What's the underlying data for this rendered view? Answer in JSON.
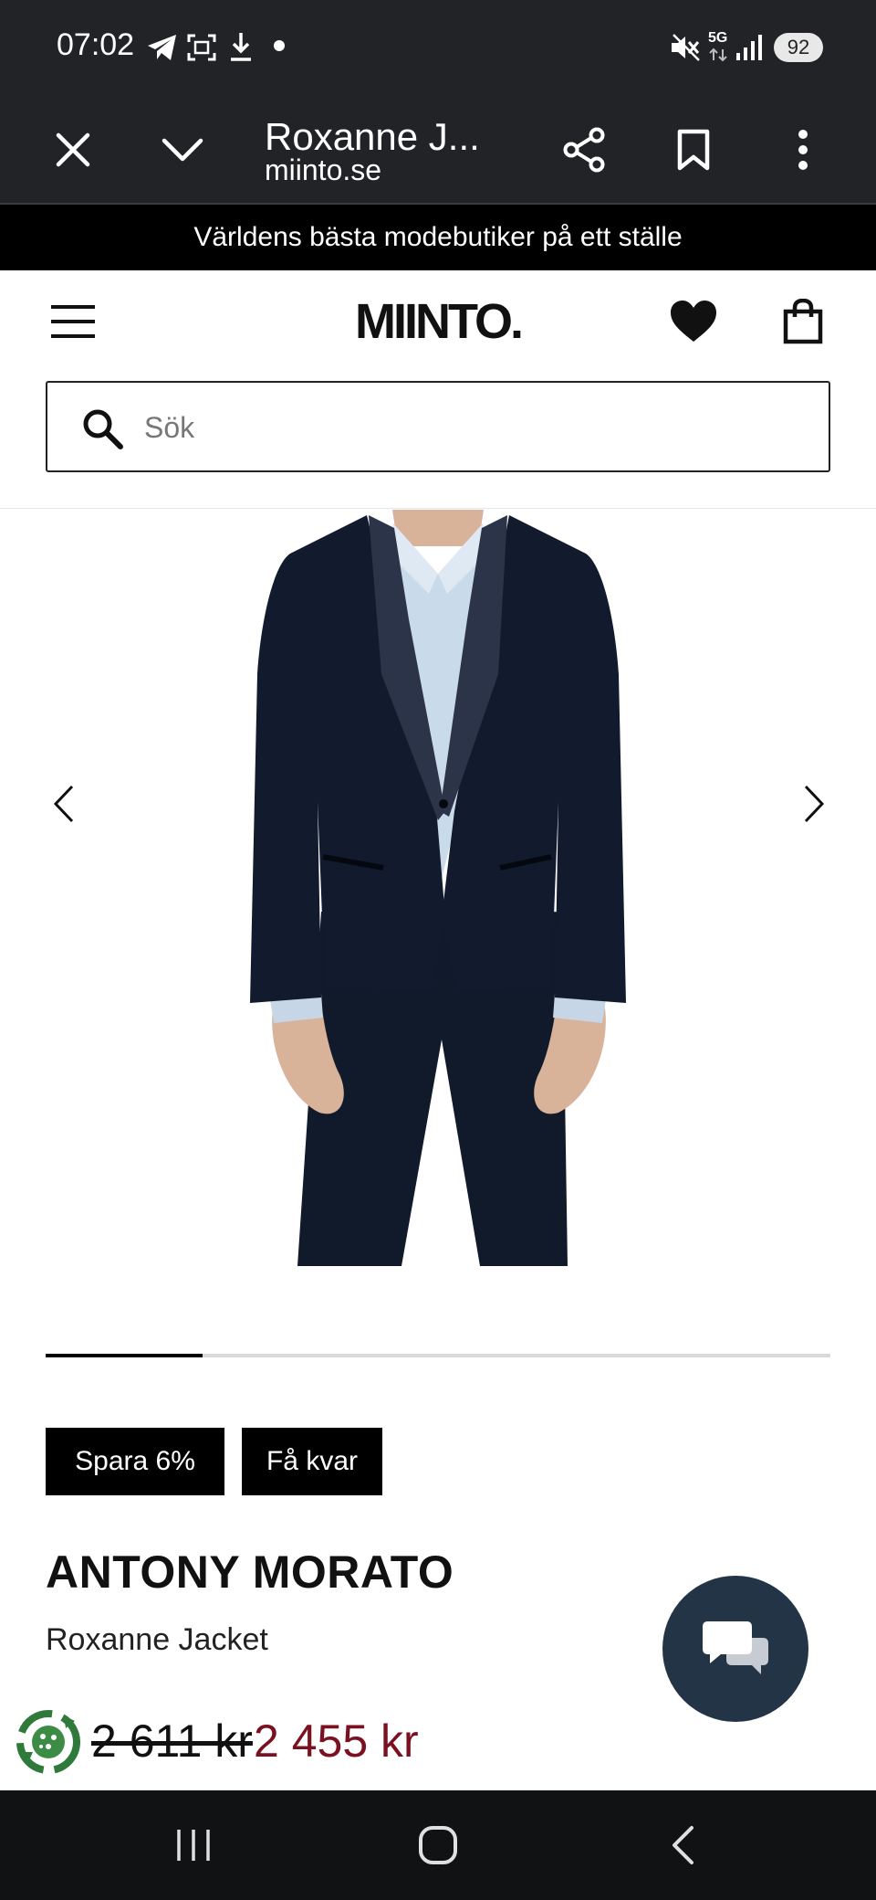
{
  "status_bar": {
    "time": "07:02",
    "battery": "92",
    "network": "5G"
  },
  "browser": {
    "title": "Roxanne J...",
    "domain": "miinto.se",
    "icons": [
      "close-icon",
      "chevron-down-icon",
      "share-icon",
      "bookmark-icon",
      "more-vert-icon"
    ]
  },
  "promo_banner": {
    "text": "Världens bästa modebutiker på ett ställe"
  },
  "header": {
    "logo": "MIINTO.",
    "search_placeholder": "Sök",
    "icons": [
      "hamburger-menu-icon",
      "heart-icon",
      "shopping-bag-icon",
      "search-icon"
    ]
  },
  "gallery": {
    "image_progress": 0.2,
    "icons": [
      "chevron-left-icon",
      "chevron-right-icon"
    ]
  },
  "product": {
    "badges": [
      "Spara 6%",
      "Få kvar"
    ],
    "brand": "ANTONY MORATO",
    "name": "Roxanne Jacket",
    "old_price": "2 611 kr",
    "new_price": "2 455 kr",
    "colors": {
      "sale_price": "#7a1020",
      "chat_button": "#243447"
    }
  }
}
